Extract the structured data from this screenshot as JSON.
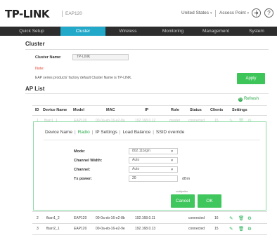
{
  "header": {
    "logo": "TP-LINK",
    "model": "EAP120",
    "country": "United States",
    "mode": "Access Point",
    "logout_icon": "logout-icon",
    "help_icon": "help-icon"
  },
  "nav": {
    "tabs": [
      {
        "label": "Quick Setup",
        "active": false
      },
      {
        "label": "Cluster",
        "active": true
      },
      {
        "label": "Wireless",
        "active": false
      },
      {
        "label": "Monitoring",
        "active": false
      },
      {
        "label": "Management",
        "active": false
      },
      {
        "label": "System",
        "active": false
      }
    ]
  },
  "cluster": {
    "title": "Cluster",
    "name_label": "Cluster Name:",
    "name_value": "TP-LINK",
    "note_label": "Note:",
    "note_text": "EAP series products' factory default Cluster Name is TP-LINK.",
    "apply_label": "Apply"
  },
  "aplist": {
    "title": "AP List",
    "refresh_label": "Refresh",
    "columns": [
      "ID",
      "Device Name",
      "Model",
      "MAC",
      "IP",
      "Role",
      "Status",
      "Clients",
      "Settings"
    ],
    "rows": [
      {
        "id": "1",
        "name": "fbarr1_1",
        "model": "EAP120",
        "mac": "00-0a-eb-16-e2-8a",
        "ip": "192.168.0.12",
        "role": "master",
        "status": "connected",
        "clients": "15"
      },
      {
        "id": "2",
        "name": "fbarr1_2",
        "model": "EAP120",
        "mac": "00-0a-eb-16-e2-8b",
        "ip": "192.168.0.11",
        "role": "",
        "status": "connected",
        "clients": "16"
      },
      {
        "id": "3",
        "name": "fbarr2_1",
        "model": "EAP120",
        "mac": "00-0a-eb-16-e2-9e",
        "ip": "192.168.0.13",
        "role": "",
        "status": "connected",
        "clients": "15"
      }
    ]
  },
  "panel": {
    "subtabs": [
      "Device Name",
      "Radio",
      "IP Settings",
      "Load Balance",
      "SSID override"
    ],
    "active_subtab": "Radio",
    "mode_label": "Mode:",
    "mode_value": "802.11b/g/n",
    "channel_width_label": "Channel Width:",
    "channel_width_value": "Auto",
    "channel_label": "Channel:",
    "channel_value": "Auto",
    "tx_label": "Tx power:",
    "tx_value": "20",
    "tx_unit": "dBm",
    "tiny_text": "sohldpelter",
    "cancel_label": "Cancel",
    "ok_label": "OK"
  },
  "colors": {
    "accent": "#22a8c9",
    "green": "#3ec55a",
    "nav_bg": "#2d2d2d",
    "note": "#e24b3b"
  }
}
